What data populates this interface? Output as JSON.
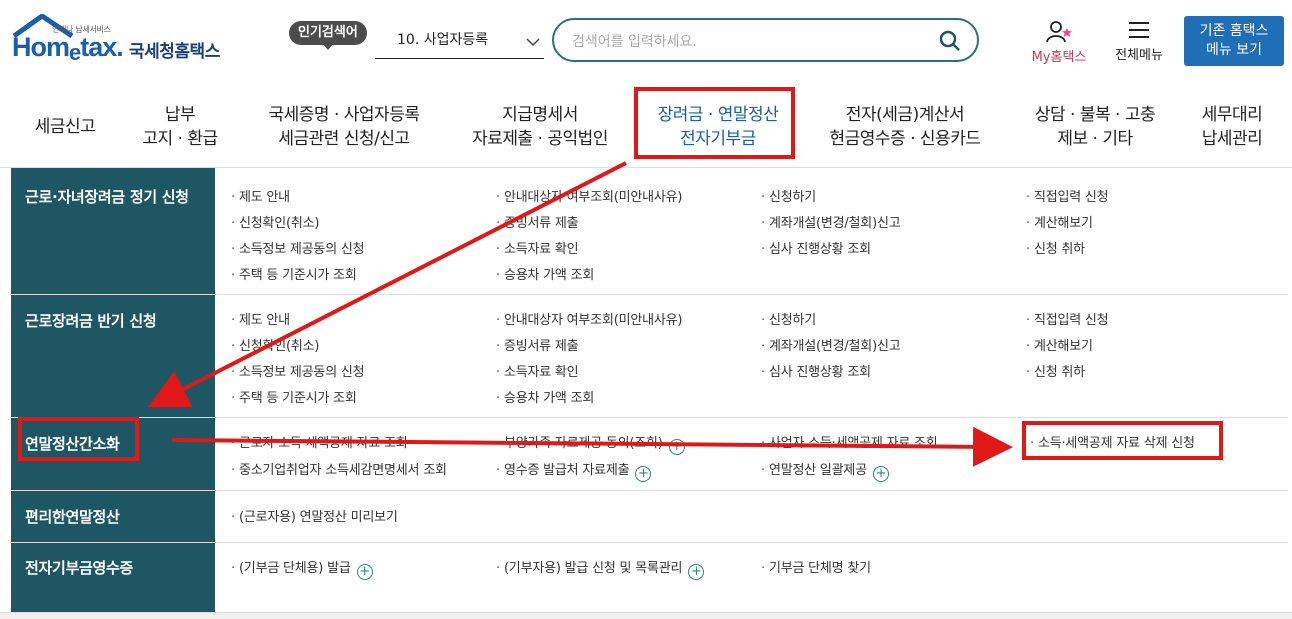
{
  "header": {
    "logo_sub": "언제나 납세서비스",
    "logo_en_pre": "Hom",
    "logo_en_e": "e",
    "logo_en_post": "tax.",
    "logo_ko": "국세청홈택스",
    "popular_badge": "인기검색어",
    "popular_selected": "10. 사업자등록",
    "search_placeholder": "검색어를 입력하세요.",
    "my_hometax": "My홈택스",
    "all_menu": "전체메뉴",
    "old_home_line1": "기존 홈택스",
    "old_home_line2": "메뉴 보기"
  },
  "gnb": [
    {
      "l1": "세금신고",
      "l2": ""
    },
    {
      "l1": "납부",
      "l2": "고지 · 환급"
    },
    {
      "l1": "국세증명 · 사업자등록",
      "l2": "세금관련 신청/신고"
    },
    {
      "l1": "지급명세서",
      "l2": "자료제출 · 공익법인"
    },
    {
      "l1": "장려금 · 연말정산",
      "l2": "전자기부금"
    },
    {
      "l1": "전자(세금)계산서",
      "l2": "현금영수증 · 신용카드"
    },
    {
      "l1": "상담 · 불복 · 고충",
      "l2": "제보 · 기타"
    },
    {
      "l1": "세무대리",
      "l2": "납세관리"
    }
  ],
  "sections": [
    {
      "title": "근로·자녀장려금 정기 신청",
      "links": [
        "제도 안내",
        "안내대상자 여부조회(미안내사유)",
        "신청하기",
        "직접입력 신청",
        "신청확인(취소)",
        "증빙서류 제출",
        "계좌개설(변경/철회)신고",
        "계산해보기",
        "소득정보 제공동의 신청",
        "소득자료 확인",
        "심사 진행상황 조회",
        "신청 취하",
        "주택 등 기준시가 조회",
        "승용차 가액 조회"
      ]
    },
    {
      "title": "근로장려금 반기 신청",
      "links": [
        "제도 안내",
        "안내대상자 여부조회(미안내사유)",
        "신청하기",
        "직접입력 신청",
        "신청확인(취소)",
        "증빙서류 제출",
        "계좌개설(변경/철회)신고",
        "계산해보기",
        "소득정보 제공동의 신청",
        "소득자료 확인",
        "심사 진행상황 조회",
        "신청 취하",
        "주택 등 기준시가 조회",
        "승용차 가액 조회"
      ]
    },
    {
      "title": "연말정산간소화",
      "links": [
        "근로자 소득·세액공제 자료 조회",
        "부양가족 자료제공 동의(조회)",
        "사업자 소득·세액공제 자료 조회",
        "소득·세액공제 자료 삭제 신청",
        "중소기업취업자 소득세감면명세서 조회",
        "영수증 발급처 자료제출",
        "연말정산 일괄제공"
      ]
    },
    {
      "title": "편리한연말정산",
      "links": [
        "(근로자용) 연말정산 미리보기"
      ]
    },
    {
      "title": "전자기부금영수증",
      "links": [
        "(기부금 단체용) 발급",
        "(기부자용) 발급 신청 및 목록관리",
        "기부금 단체명 찾기"
      ]
    }
  ],
  "colors": {
    "accent_red": "#e01818",
    "side_bg": "#1f5663",
    "brand_blue": "#1e6fb5"
  }
}
